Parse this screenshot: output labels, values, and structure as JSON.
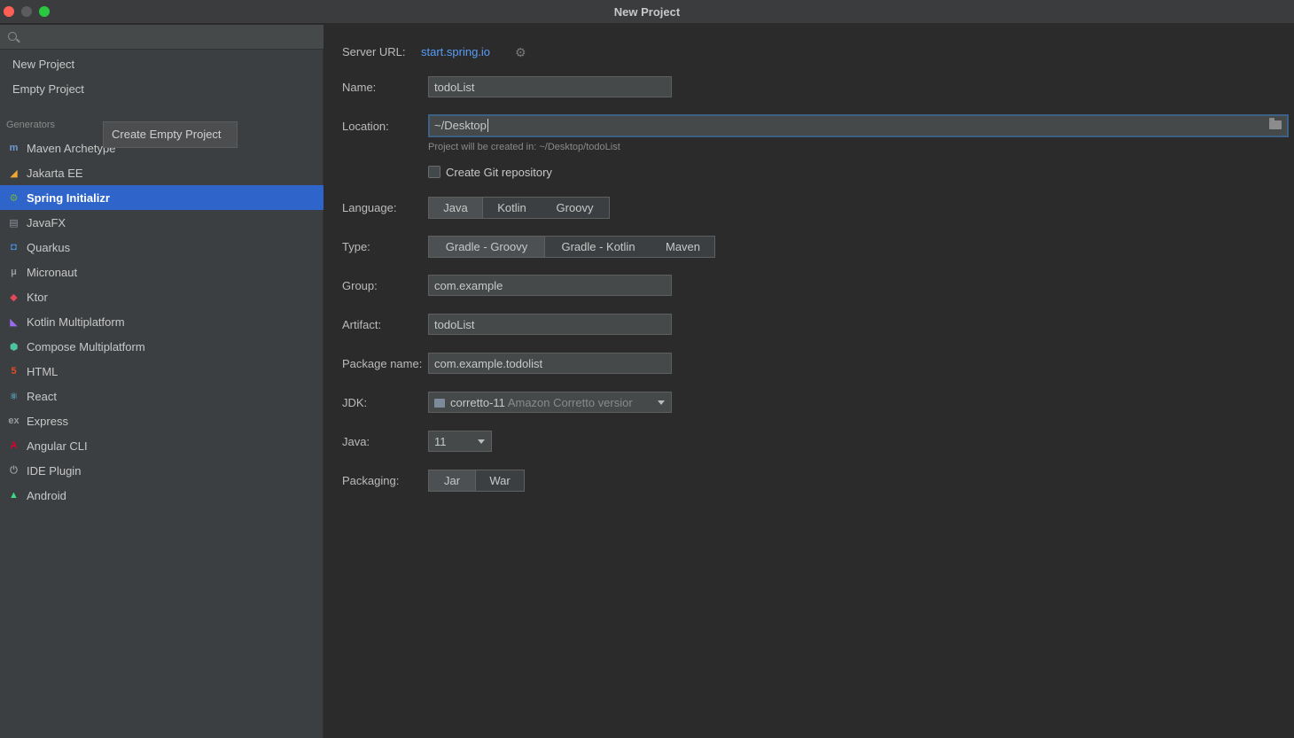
{
  "window": {
    "title": "New Project"
  },
  "sidebar": {
    "search_placeholder": "",
    "top_items": [
      "New Project",
      "Empty Project"
    ],
    "tooltip": "Create Empty Project",
    "section_label": "Generators",
    "generators": [
      {
        "label": "Maven Archetype",
        "icon": "maven-icon",
        "glyph": "m",
        "color": "#6f9bd1"
      },
      {
        "label": "Jakarta EE",
        "icon": "jakarta-icon",
        "glyph": "◢",
        "color": "#f0a830"
      },
      {
        "label": "Spring Initializr",
        "icon": "spring-icon",
        "glyph": "⚙",
        "color": "#6db33f"
      },
      {
        "label": "JavaFX",
        "icon": "javafx-icon",
        "glyph": "▤",
        "color": "#8a9199"
      },
      {
        "label": "Quarkus",
        "icon": "quarkus-icon",
        "glyph": "◘",
        "color": "#4695eb"
      },
      {
        "label": "Micronaut",
        "icon": "micronaut-icon",
        "glyph": "μ",
        "color": "#9a9a9a"
      },
      {
        "label": "Ktor",
        "icon": "ktor-icon",
        "glyph": "◆",
        "color": "#e44857"
      },
      {
        "label": "Kotlin Multiplatform",
        "icon": "kotlin-icon",
        "glyph": "◣",
        "color": "#9a6bf0"
      },
      {
        "label": "Compose Multiplatform",
        "icon": "compose-icon",
        "glyph": "⬢",
        "color": "#4fc3a1"
      },
      {
        "label": "HTML",
        "icon": "html-icon",
        "glyph": "5",
        "color": "#e34c26"
      },
      {
        "label": "React",
        "icon": "react-icon",
        "glyph": "⚛",
        "color": "#61dafb"
      },
      {
        "label": "Express",
        "icon": "express-icon",
        "glyph": "ex",
        "color": "#9a9a9a"
      },
      {
        "label": "Angular CLI",
        "icon": "angular-icon",
        "glyph": "A",
        "color": "#dd0031"
      },
      {
        "label": "IDE Plugin",
        "icon": "plugin-icon",
        "glyph": "⏻",
        "color": "#9a9a9a"
      },
      {
        "label": "Android",
        "icon": "android-icon",
        "glyph": "▲",
        "color": "#3ddc84"
      }
    ],
    "selected_index": 2
  },
  "form": {
    "server_url_label": "Server URL:",
    "server_url": "start.spring.io",
    "name_label": "Name:",
    "name_value": "todoList",
    "location_label": "Location:",
    "location_value": "~/Desktop",
    "location_hint": "Project will be created in: ~/Desktop/todoList",
    "git_label": "Create Git repository",
    "git_checked": false,
    "language_label": "Language:",
    "language_options": [
      "Java",
      "Kotlin",
      "Groovy"
    ],
    "language_selected": "Java",
    "type_label": "Type:",
    "type_options": [
      "Gradle - Groovy",
      "Gradle - Kotlin",
      "Maven"
    ],
    "type_selected": "Gradle - Groovy",
    "group_label": "Group:",
    "group_value": "com.example",
    "artifact_label": "Artifact:",
    "artifact_value": "todoList",
    "package_label": "Package name:",
    "package_value": "com.example.todolist",
    "jdk_label": "JDK:",
    "jdk_name": "corretto-11",
    "jdk_detail": "Amazon Corretto versior",
    "java_label": "Java:",
    "java_value": "11",
    "packaging_label": "Packaging:",
    "packaging_options": [
      "Jar",
      "War"
    ],
    "packaging_selected": "Jar"
  }
}
